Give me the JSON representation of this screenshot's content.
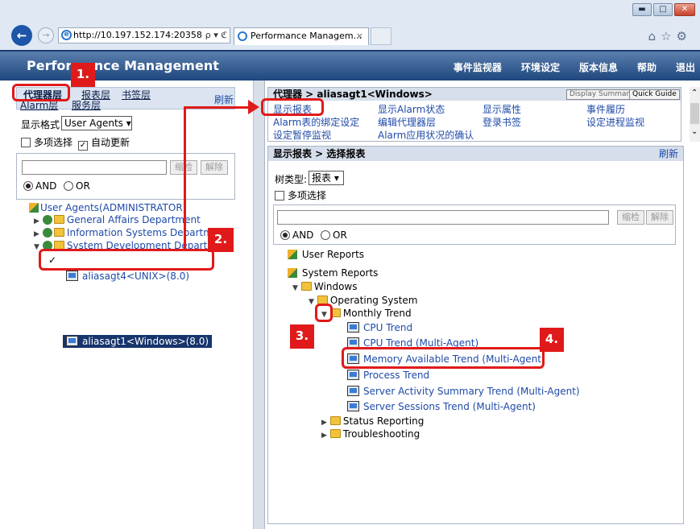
{
  "browser": {
    "address": "http://10.197.152.174:20358",
    "tab_title": "Performance Managem...",
    "tab_close": "×",
    "address_tools": "ρ ▾ ℭ"
  },
  "app": {
    "title": "Performance Management",
    "menu": [
      "事件监视器",
      "环境设定",
      "版本信息",
      "帮助",
      "退出"
    ]
  },
  "left": {
    "tabs": [
      "代理器层",
      "报表层",
      "书签层",
      "Alarm层",
      "服务层"
    ],
    "refresh": "刷新",
    "display_format_label": "显示格式",
    "display_format_value": "User Agents",
    "multi_select": "多项选择",
    "auto_update": "自动更新",
    "filter_btn": "缩检",
    "clear_btn": "解除",
    "and_label": "AND",
    "or_label": "OR",
    "tree": {
      "root": "User Agents(ADMINISTRATOR)",
      "groups": [
        "General Affairs Department",
        "Information Systems Department",
        "System Development Department"
      ],
      "selected_agent": "aliasagt1<Windows>(8.0)",
      "other_agent": "aliasagt4<UNIX>(8.0)"
    }
  },
  "right_top": {
    "header": "代理器 > aliasagt1<Windows>",
    "display_summary": "Display Summary",
    "quick_guide": "Quick Guide",
    "links": [
      "显示报表",
      "显示Alarm状态",
      "显示属性",
      "事件履历",
      "Alarm表的绑定设定",
      "编辑代理器层",
      "登录书签",
      "设定进程监视",
      "设定暂停监视",
      "Alarm应用状况的确认"
    ]
  },
  "right_main": {
    "header": "显示报表 > 选择报表",
    "refresh": "刷新",
    "tree_type_label": "树类型:",
    "tree_type_value": "报表",
    "multi_select": "多项选择",
    "filter_btn": "缩检",
    "clear_btn": "解除",
    "and_label": "AND",
    "or_label": "OR",
    "tree": {
      "user_reports": "User Reports",
      "system_reports": "System Reports",
      "windows": "Windows",
      "os": "Operating System",
      "monthly": "Monthly Trend",
      "reports": [
        "CPU Trend",
        "CPU Trend (Multi-Agent)",
        "Memory Available Trend (Multi-Agent)",
        "Process Trend",
        "Server Activity Summary Trend (Multi-Agent)",
        "Server Sessions Trend (Multi-Agent)"
      ],
      "status_reporting": "Status Reporting",
      "troubleshooting": "Troubleshooting"
    }
  },
  "annotations": [
    "1.",
    "2.",
    "3.",
    "4."
  ],
  "colors": {
    "annotation_red": "#e01a1a",
    "header_blue": "#1f477e",
    "selection_navy": "#17346c",
    "link_blue": "#1f4aa8"
  }
}
